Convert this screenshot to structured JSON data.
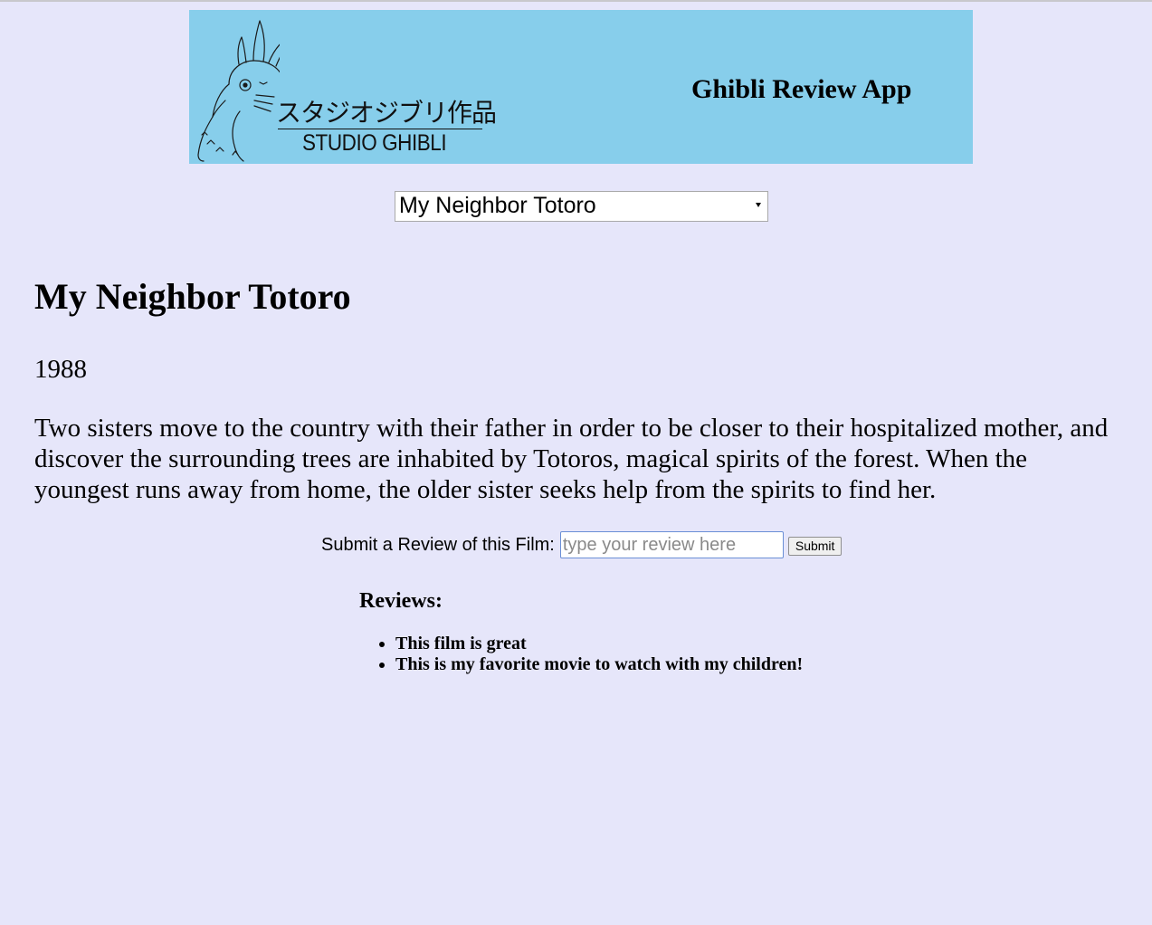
{
  "header": {
    "logo": {
      "japanese_text": "スタジオジブリ作品",
      "english_text": "STUDIO GHIBLI",
      "icon": "totoro-logo-icon"
    },
    "app_title": "Ghibli Review App",
    "background_color": "#87ceeb"
  },
  "film_select": {
    "selected": "My Neighbor Totoro"
  },
  "film": {
    "title": "My Neighbor Totoro",
    "year": "1988",
    "description": "Two sisters move to the country with their father in order to be closer to their hospitalized mother, and discover the surrounding trees are inhabited by Totoros, magical spirits of the forest. When the youngest runs away from home, the older sister seeks help from the spirits to find her."
  },
  "review_form": {
    "label": "Submit a Review of this Film:",
    "placeholder": "type your review here",
    "value": "",
    "submit_label": "Submit"
  },
  "reviews": {
    "heading": "Reviews:",
    "items": [
      "This film is great",
      "This is my favorite movie to watch with my children!"
    ]
  },
  "theme": {
    "page_background": "#e6e6fa"
  }
}
